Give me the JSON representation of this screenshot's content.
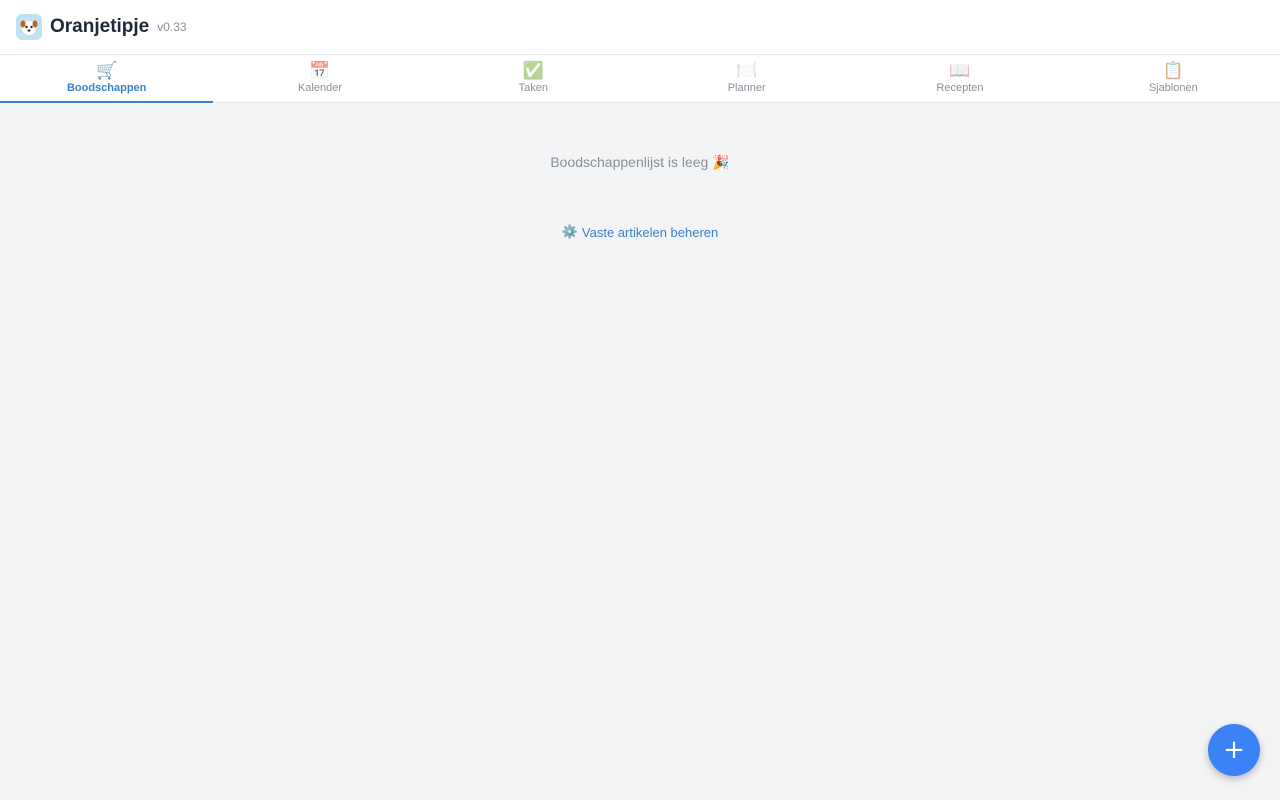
{
  "header": {
    "logo_icon": "dog-face-icon",
    "title": "Oranjetipje",
    "version": "v0.33"
  },
  "tabs": [
    {
      "label": "Boodschappen",
      "icon": "🛒",
      "icon_name": "shopping-cart-icon",
      "active": true
    },
    {
      "label": "Kalender",
      "icon": "📅",
      "icon_name": "calendar-icon",
      "active": false
    },
    {
      "label": "Taken",
      "icon": "✅",
      "icon_name": "checkmark-icon",
      "active": false
    },
    {
      "label": "Planner",
      "icon": "🍽️",
      "icon_name": "plate-cutlery-icon",
      "active": false
    },
    {
      "label": "Recepten",
      "icon": "📖",
      "icon_name": "book-icon",
      "active": false
    },
    {
      "label": "Sjablonen",
      "icon": "📋",
      "icon_name": "clipboard-icon",
      "active": false
    }
  ],
  "main": {
    "empty_message": "Boodschappenlijst is leeg 🎉",
    "manage_link_icon": "⚙️",
    "manage_link_label": "Vaste artikelen beheren"
  },
  "fab": {
    "label": "+"
  },
  "colors": {
    "accent": "#3b82c4",
    "fab": "#3b82f6",
    "background": "#f3f4f6",
    "muted_text": "#8a8f98"
  }
}
